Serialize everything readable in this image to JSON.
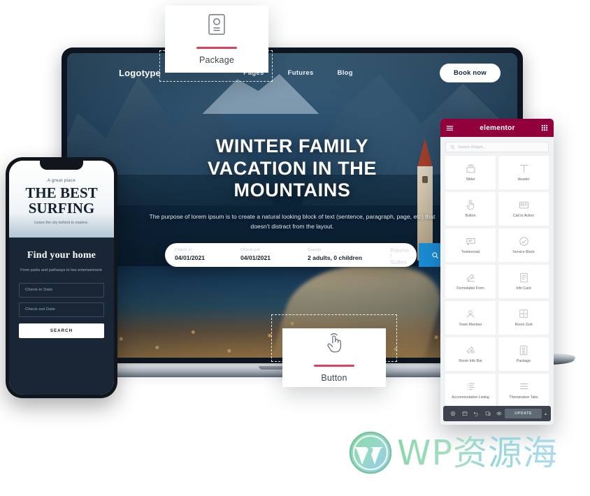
{
  "page": {
    "background": "#ffffff"
  },
  "laptop": {
    "nav": {
      "logotype": "Logotype",
      "items": [
        "Pages",
        "Futures",
        "Blog"
      ],
      "cta_label": "Book now"
    },
    "hero": {
      "heading_line1": "WINTER FAMILY",
      "heading_line2": "VACATION IN THE",
      "heading_line3": "MOUNTAINS",
      "subtext": "The purpose of lorem ipsum is to create a natural looking block of text (sentence, paragraph, page, etc) that doesn't distract from the layout."
    },
    "search": {
      "checkin_label": "Check in",
      "checkin_value": "04/01/2021",
      "checkout_label": "Check out",
      "checkout_value": "04/01/2021",
      "guests_label": "Guests",
      "guests_value": "2 adults, 0 children",
      "rooms_placeholder": "Rooms / Suites",
      "search_icon": "search-icon",
      "button_color": "#1b8cd4"
    }
  },
  "floating_cards": [
    {
      "label": "Package",
      "icon": "package-card-icon",
      "accent": "#e0415f"
    },
    {
      "label": "Button",
      "icon": "click-hand-icon",
      "accent": "#e0415f"
    }
  ],
  "phone": {
    "hero": {
      "eyebrow": "A great place",
      "title_line1": "THE BEST",
      "title_line2": "SURFING",
      "tagline": "Leave the city behind to explore."
    },
    "form": {
      "heading": "Find your home",
      "subtext": "From parks and pathways to live entertainment.",
      "checkin_placeholder": "Check-in Date",
      "checkout_placeholder": "Check-out Date",
      "search_label": "SEARCH"
    }
  },
  "elementor": {
    "brand": "elementor",
    "brand_color": "#92003b",
    "menu_icon": "hamburger-icon",
    "grid_icon": "apps-grid-icon",
    "search_placeholder": "Search Widget...",
    "search_icon": "search-icon",
    "widgets": [
      {
        "label": "Slider",
        "icon": "slider-icon"
      },
      {
        "label": "Header",
        "icon": "header-text-icon"
      },
      {
        "label": "Button",
        "icon": "click-hand-icon"
      },
      {
        "label": "Call to Action",
        "icon": "call-to-action-icon"
      },
      {
        "label": "Testimonial",
        "icon": "speech-bubble-icon"
      },
      {
        "label": "Service Block",
        "icon": "check-circle-icon"
      },
      {
        "label": "Formidable Form",
        "icon": "form-pen-icon"
      },
      {
        "label": "Info Card",
        "icon": "document-list-icon"
      },
      {
        "label": "Team Member",
        "icon": "person-icon"
      },
      {
        "label": "Room Grid",
        "icon": "grid-four-icon"
      },
      {
        "label": "Room Info Bar",
        "icon": "pen-bar-icon"
      },
      {
        "label": "Package",
        "icon": "package-card-icon"
      },
      {
        "label": "Accommodation Listing",
        "icon": "list-bullets-icon"
      },
      {
        "label": "Themeration Tabs",
        "icon": "tabs-lines-icon"
      }
    ],
    "footer": {
      "settings_icon": "gear-icon",
      "navigator_icon": "navigator-icon",
      "history_icon": "history-undo-icon",
      "responsive_icon": "responsive-mode-icon",
      "preview_icon": "preview-eye-icon",
      "update_label": "UPDATE",
      "caret_icon": "chevron-up-icon"
    }
  },
  "watermark": {
    "logo_icon": "wordpress-logo-icon",
    "text": "WP资源海"
  }
}
